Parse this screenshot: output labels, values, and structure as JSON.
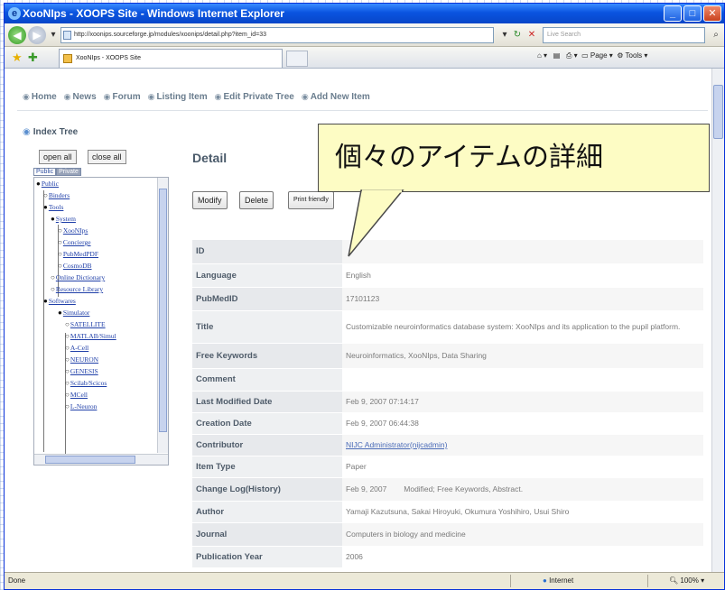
{
  "window": {
    "title": "XooNIps - XOOPS Site - Windows Internet Explorer",
    "url": "http://xoonips.sourceforge.jp/modules/xoonips/detail.php?item_id=33",
    "search_placeholder": "Live Search",
    "tab_title": "XooNIps - XOOPS Site",
    "page_menu": "Page",
    "tools_menu": "Tools"
  },
  "menu": [
    "Home",
    "News",
    "Forum",
    "Listing Item",
    "Edit Private Tree",
    "Add New Item"
  ],
  "index_tree": {
    "title": "Index Tree",
    "open_all": "open all",
    "close_all": "close all",
    "tabs": [
      "Public",
      "Private"
    ],
    "nodes": [
      "Public",
      "Binders",
      "Tools",
      "System",
      "XooNIps",
      "Concierge",
      "PubMedPDF",
      "CosmoDB",
      "Online Dictionary",
      "Resource Library",
      "Softwares",
      "Simulator",
      "SATELLITE",
      "MATLAB/Simul",
      "A-Cell",
      "NEURON",
      "GENESIS",
      "Scilab/Scicos",
      "MCell",
      "L-Neuron"
    ]
  },
  "detail": {
    "title": "Detail",
    "buttons": [
      "Modify",
      "Delete",
      "Print friendly"
    ],
    "rows": [
      {
        "label": "ID",
        "value": ""
      },
      {
        "label": "Language",
        "value": "English"
      },
      {
        "label": "PubMedID",
        "value": "17101123"
      },
      {
        "label": "Title",
        "value": "Customizable neuroinformatics database system: XooNIps and its application to the pupil platform."
      },
      {
        "label": "Free Keywords",
        "value": "Neuroinformatics, XooNIps, Data Sharing"
      },
      {
        "label": "Comment",
        "value": ""
      },
      {
        "label": "Last Modified Date",
        "value": "Feb 9, 2007 07:14:17"
      },
      {
        "label": "Creation Date",
        "value": "Feb 9, 2007 06:44:38"
      },
      {
        "label": "Contributor",
        "value": "NIJC Administrator(nijcadmin)"
      },
      {
        "label": "Item Type",
        "value": "Paper"
      },
      {
        "label": "Change Log(History)",
        "value": "Feb 9, 2007        Modified; Free Keywords, Abstract."
      },
      {
        "label": "Author",
        "value": "Yamaji Kazutsuna, Sakai Hiroyuki, Okumura Yoshihiro, Usui Shiro"
      },
      {
        "label": "Journal",
        "value": "Computers in biology and medicine"
      },
      {
        "label": "Publication Year",
        "value": "2006"
      }
    ]
  },
  "callout": {
    "text": "個々のアイテムの詳細"
  },
  "status": {
    "left": "Done",
    "zone": "Internet",
    "zoom": "100%"
  }
}
